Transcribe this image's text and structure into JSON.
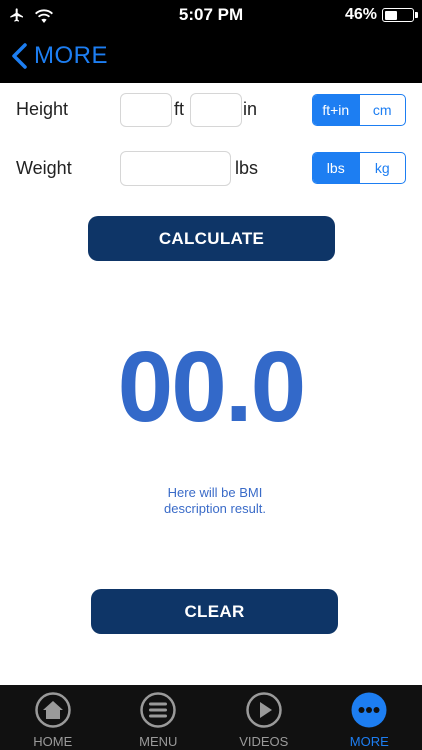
{
  "status_bar": {
    "time": "5:07 PM",
    "battery_text": "46%",
    "battery_level": 0.46,
    "icons": [
      "airplane-icon",
      "wifi-icon",
      "battery-icon"
    ]
  },
  "nav": {
    "back_label": "MORE"
  },
  "height": {
    "label": "Height",
    "feet_value": "",
    "inches_value": "",
    "feet_unit": "ft",
    "inches_unit": "in",
    "segments": [
      "ft+in",
      "cm"
    ],
    "selected": "ft+in"
  },
  "weight": {
    "label": "Weight",
    "value": "",
    "unit": "lbs",
    "segments": [
      "lbs",
      "kg"
    ],
    "selected": "lbs"
  },
  "calculate_label": "CALCULATE",
  "result": {
    "bmi": "00.0",
    "description_line1": "Here will be BMI",
    "description_line2": "description result."
  },
  "clear_label": "CLEAR",
  "tabs": [
    {
      "label": "HOME",
      "icon": "home-icon",
      "active": false
    },
    {
      "label": "MENU",
      "icon": "menu-icon",
      "active": false
    },
    {
      "label": "VIDEOS",
      "icon": "play-icon",
      "active": false
    },
    {
      "label": "MORE",
      "icon": "more-icon",
      "active": true
    }
  ],
  "colors": {
    "accent": "#1d7ef2",
    "button_dark": "#0e3567",
    "bmi_value": "#3369c9",
    "bar_background": "#000000"
  }
}
